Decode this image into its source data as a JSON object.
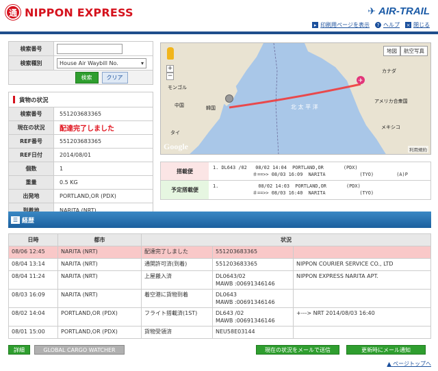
{
  "header": {
    "logo_mark": "通",
    "logo_text": "NIPPON EXPRESS",
    "airtrail": "AIR-TRAIL",
    "links": [
      "印刷用ページを表示",
      "ヘルプ",
      "閉じる"
    ]
  },
  "search": {
    "number_label": "検索番号",
    "number_value": "",
    "type_label": "検索種別",
    "type_value": "House Air Waybill No.",
    "search_button": "検索",
    "clear_button": "クリア"
  },
  "status": {
    "title": "貨物の状況",
    "rows": [
      {
        "label": "検索番号",
        "value": "551203683365"
      },
      {
        "label": "現在の状況",
        "value": "配達完了しました"
      },
      {
        "label": "REF番号",
        "value": "551203683365"
      },
      {
        "label": "REF日付",
        "value": "2014/08/01"
      },
      {
        "label": "個数",
        "value": "1"
      },
      {
        "label": "重量",
        "value": "0.5 KG"
      },
      {
        "label": "出発地",
        "value": "PORTLAND,OR (PDX)"
      },
      {
        "label": "到着地",
        "value": "NARITA (NRT)"
      }
    ]
  },
  "map": {
    "buttons": [
      "地図",
      "航空写真"
    ],
    "labels": {
      "mongolia": "モンゴル",
      "china": "中国",
      "korea": "韓国",
      "thai": "タイ",
      "pacific": "北 太 平 洋",
      "canada": "カナダ",
      "usa": "アメリカ合衆国",
      "mexico": "メキシコ"
    },
    "google": "Google",
    "terms": "利用規約"
  },
  "flights": [
    {
      "label": "搭載便",
      "text": "1. DL643 /02   08/02 14:04  PORTLAND,OR       (PDX)\n              ＃==>> 08/03 16:09  NARITA            (TYO)        (A)P"
    },
    {
      "label": "予定搭載便",
      "text": "1.              08/02 14:03  PORTLAND,OR       (PDX)\n              ＃==>> 08/03 16:40  NARITA            (TYO)"
    }
  ],
  "history": {
    "title": "経歴",
    "columns": [
      "日時",
      "都市",
      "状況"
    ],
    "rows": [
      {
        "date": "08/06 12:45",
        "city": "NARITA (NRT)",
        "status": "配達完了しました",
        "detail": "551203683365",
        "extra": ""
      },
      {
        "date": "08/04 13:14",
        "city": "NARITA (NRT)",
        "status": "通関許可済(到着)",
        "detail": "551203683365",
        "extra": "NIPPON COURIER SERVICE CO., LTD"
      },
      {
        "date": "08/04 11:24",
        "city": "NARITA (NRT)",
        "status": "上屋搬入済",
        "detail": "DL0643/02\nMAWB :00691346146",
        "extra": "NIPPON EXPRESS NARITA APT."
      },
      {
        "date": "08/03 16:09",
        "city": "NARITA (NRT)",
        "status": "着空港に貨物到着",
        "detail": "DL0643\nMAWB :00691346146",
        "extra": ""
      },
      {
        "date": "08/02 14:04",
        "city": "PORTLAND,OR (PDX)",
        "status": "フライト搭載済(1ST)",
        "detail": "DL643 /02\nMAWB :00691346146",
        "extra": "+---> NRT 2014/08/03 16:40"
      },
      {
        "date": "08/01 15:00",
        "city": "PORTLAND,OR (PDX)",
        "status": "貨物受領済",
        "detail": "NEU58E03144",
        "extra": ""
      }
    ]
  },
  "footer": {
    "detail_button": "詳細",
    "gcw_button": "GLOBAL CARGO WATCHER",
    "mail_now_button": "現在の状況をメールで送信",
    "mail_update_button": "更新時にメール通知",
    "page_top": "ページトップへ"
  },
  "colors": {
    "brand_red": "#d5121d",
    "brand_blue": "#1a5aa6",
    "green": "#2f9e2f",
    "highlight": "#f9c8c8"
  }
}
